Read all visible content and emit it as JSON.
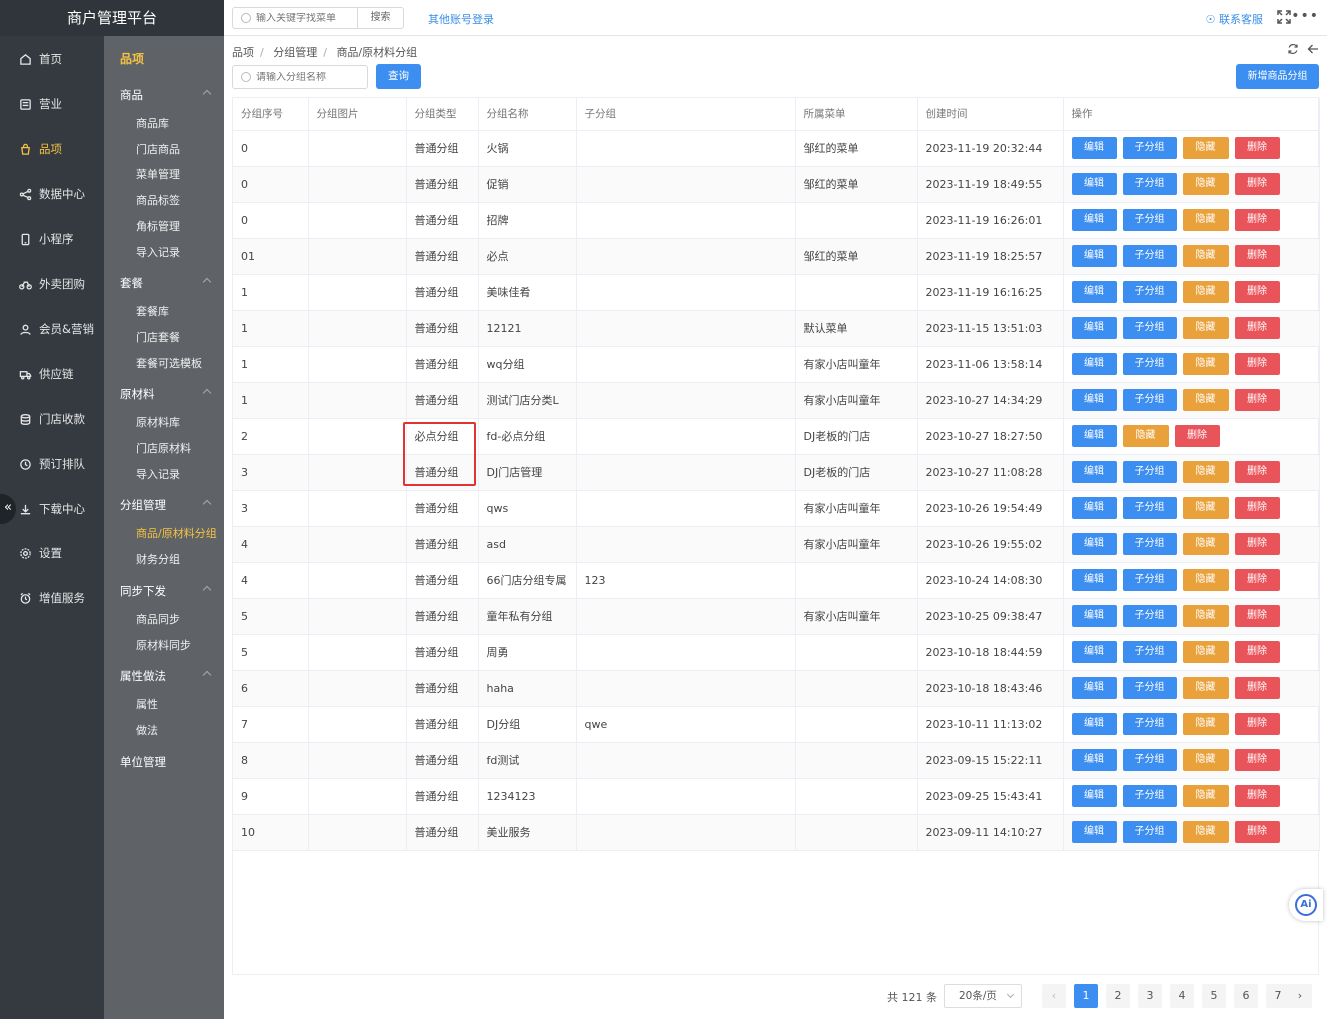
{
  "app": {
    "title": "商户管理平台"
  },
  "nav": [
    {
      "label": "首页",
      "icon": "home-icon",
      "active": false
    },
    {
      "label": "营业",
      "icon": "business-icon",
      "active": false
    },
    {
      "label": "品项",
      "icon": "bag-icon",
      "active": true
    },
    {
      "label": "数据中心",
      "icon": "share-icon",
      "active": false
    },
    {
      "label": "小程序",
      "icon": "phone-icon",
      "active": false
    },
    {
      "label": "外卖团购",
      "icon": "bike-icon",
      "active": false
    },
    {
      "label": "会员&营销",
      "icon": "user-icon",
      "active": false
    },
    {
      "label": "供应链",
      "icon": "truck-icon",
      "active": false
    },
    {
      "label": "门店收款",
      "icon": "database-icon",
      "active": false
    },
    {
      "label": "预订排队",
      "icon": "clock-icon",
      "active": false
    },
    {
      "label": "下载中心",
      "icon": "download-icon",
      "active": false
    },
    {
      "label": "设置",
      "icon": "gear-icon",
      "active": false
    },
    {
      "label": "增值服务",
      "icon": "alarm-icon",
      "active": false
    }
  ],
  "subnav": {
    "title": "品项",
    "groups": [
      {
        "label": "商品",
        "items": [
          "商品库",
          "门店商品",
          "菜单管理",
          "商品标签",
          "角标管理",
          "导入记录"
        ]
      },
      {
        "label": "套餐",
        "items": [
          "套餐库",
          "门店套餐",
          "套餐可选模板"
        ]
      },
      {
        "label": "原材料",
        "items": [
          "原材料库",
          "门店原材料",
          "导入记录"
        ]
      },
      {
        "label": "分组管理",
        "items": [
          "商品/原材料分组",
          "财务分组"
        ]
      },
      {
        "label": "同步下发",
        "items": [
          "商品同步",
          "原材料同步"
        ]
      },
      {
        "label": "属性做法",
        "items": [
          "属性",
          "做法"
        ]
      },
      {
        "label": "单位管理",
        "items": []
      }
    ],
    "active_item": "商品/原材料分组"
  },
  "topbar": {
    "search_placeholder": "输入关键字找菜单",
    "search_button": "搜索",
    "other_login": "其他账号登录",
    "contact": "联系客服"
  },
  "breadcrumb": [
    "品项",
    "分组管理",
    "商品/原材料分组"
  ],
  "filter": {
    "placeholder": "请输入分组名称",
    "query_button": "查询",
    "add_button": "新增商品分组"
  },
  "table": {
    "columns": [
      "分组序号",
      "分组图片",
      "分组类型",
      "分组名称",
      "子分组",
      "所属菜单",
      "创建时间",
      "操作"
    ],
    "actions": {
      "edit": "编辑",
      "sub": "子分组",
      "hide": "隐藏",
      "delete": "删除"
    },
    "rows": [
      {
        "seq": "0",
        "img": "",
        "type": "普通分组",
        "name": "火锅",
        "sub": "",
        "menu": "邹红的菜单",
        "time": "2023-11-19 20:32:44",
        "has_sub": true
      },
      {
        "seq": "0",
        "img": "",
        "type": "普通分组",
        "name": "促销",
        "sub": "",
        "menu": "邹红的菜单",
        "time": "2023-11-19 18:49:55",
        "has_sub": true
      },
      {
        "seq": "0",
        "img": "",
        "type": "普通分组",
        "name": "招牌",
        "sub": "",
        "menu": "",
        "time": "2023-11-19 16:26:01",
        "has_sub": true
      },
      {
        "seq": "01",
        "img": "",
        "type": "普通分组",
        "name": "必点",
        "sub": "",
        "menu": "邹红的菜单",
        "time": "2023-11-19 18:25:57",
        "has_sub": true
      },
      {
        "seq": "1",
        "img": "",
        "type": "普通分组",
        "name": "美味佳肴",
        "sub": "",
        "menu": "",
        "time": "2023-11-19 16:16:25",
        "has_sub": true
      },
      {
        "seq": "1",
        "img": "",
        "type": "普通分组",
        "name": "12121",
        "sub": "",
        "menu": "默认菜单",
        "time": "2023-11-15 13:51:03",
        "has_sub": true
      },
      {
        "seq": "1",
        "img": "",
        "type": "普通分组",
        "name": "wq分组",
        "sub": "",
        "menu": "有家小店叫童年",
        "time": "2023-11-06 13:58:14",
        "has_sub": true
      },
      {
        "seq": "1",
        "img": "",
        "type": "普通分组",
        "name": "测试门店分类L",
        "sub": "",
        "menu": "有家小店叫童年",
        "time": "2023-10-27 14:34:29",
        "has_sub": true
      },
      {
        "seq": "2",
        "img": "",
        "type": "必点分组",
        "name": "fd-必点分组",
        "sub": "",
        "menu": "DJ老板的门店",
        "time": "2023-10-27 18:27:50",
        "has_sub": false
      },
      {
        "seq": "3",
        "img": "",
        "type": "普通分组",
        "name": "DJ门店管理",
        "sub": "",
        "menu": "DJ老板的门店",
        "time": "2023-10-27 11:08:28",
        "has_sub": true
      },
      {
        "seq": "3",
        "img": "",
        "type": "普通分组",
        "name": "qws",
        "sub": "",
        "menu": "有家小店叫童年",
        "time": "2023-10-26 19:54:49",
        "has_sub": true
      },
      {
        "seq": "4",
        "img": "",
        "type": "普通分组",
        "name": "asd",
        "sub": "",
        "menu": "有家小店叫童年",
        "time": "2023-10-26 19:55:02",
        "has_sub": true
      },
      {
        "seq": "4",
        "img": "",
        "type": "普通分组",
        "name": "66门店分组专属",
        "sub": "123",
        "menu": "",
        "time": "2023-10-24 14:08:30",
        "has_sub": true
      },
      {
        "seq": "5",
        "img": "",
        "type": "普通分组",
        "name": "童年私有分组",
        "sub": "",
        "menu": "有家小店叫童年",
        "time": "2023-10-25 09:38:47",
        "has_sub": true
      },
      {
        "seq": "5",
        "img": "",
        "type": "普通分组",
        "name": "周勇",
        "sub": "",
        "menu": "",
        "time": "2023-10-18 18:44:59",
        "has_sub": true
      },
      {
        "seq": "6",
        "img": "",
        "type": "普通分组",
        "name": "haha",
        "sub": "",
        "menu": "",
        "time": "2023-10-18 18:43:46",
        "has_sub": true
      },
      {
        "seq": "7",
        "img": "",
        "type": "普通分组",
        "name": "DJ分组",
        "sub": "qwe",
        "menu": "",
        "time": "2023-10-11 11:13:02",
        "has_sub": true
      },
      {
        "seq": "8",
        "img": "",
        "type": "普通分组",
        "name": "fd测试",
        "sub": "",
        "menu": "",
        "time": "2023-09-15 15:22:11",
        "has_sub": true
      },
      {
        "seq": "9",
        "img": "",
        "type": "普通分组",
        "name": "1234123",
        "sub": "",
        "menu": "",
        "time": "2023-09-25 15:43:41",
        "has_sub": true
      },
      {
        "seq": "10",
        "img": "",
        "type": "普通分组",
        "name": "美业服务",
        "sub": "",
        "menu": "",
        "time": "2023-09-11 14:10:27",
        "has_sub": true
      }
    ]
  },
  "pagination": {
    "total": "共 121 条",
    "page_size": "20条/页",
    "pages": [
      "1",
      "2",
      "3",
      "4",
      "5",
      "6",
      "7"
    ],
    "current": "1"
  },
  "colors": {
    "accent": "#3c8ef0",
    "warning": "#e9a23b",
    "danger": "#e8545a",
    "active_nav": "#f5c242"
  }
}
